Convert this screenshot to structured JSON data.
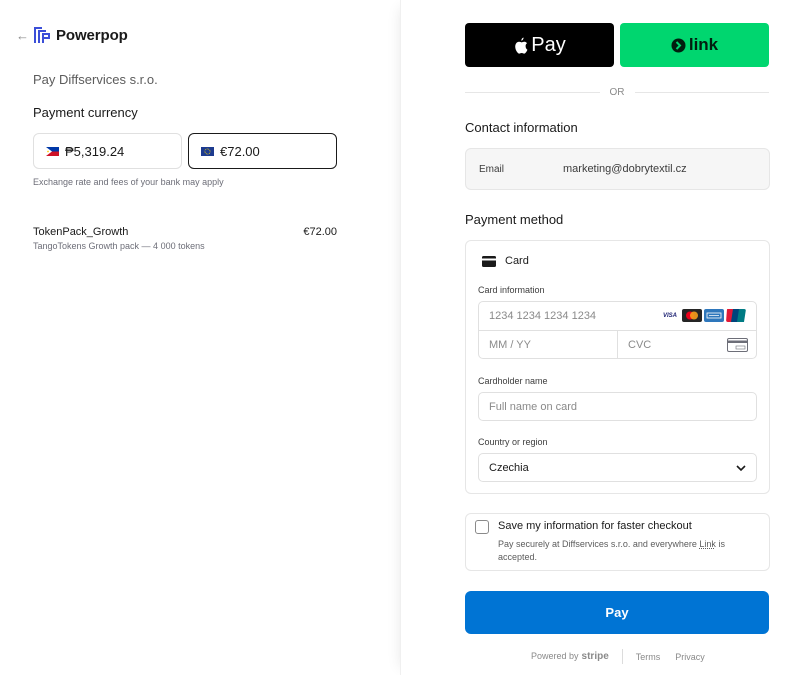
{
  "brand": {
    "name": "Powerpop",
    "back_glyph": "←"
  },
  "order": {
    "pay_to": "Pay Diffservices s.r.o.",
    "currency_title": "Payment currency",
    "currencies": [
      {
        "label": "₱5,319.24",
        "flag": "philippines-flag-icon"
      },
      {
        "label": "€72.00",
        "flag": "eu-flag-icon",
        "selected": true
      }
    ],
    "exchange_note": "Exchange rate and fees of your bank may apply",
    "item": {
      "name": "TokenPack_Growth",
      "price": "€72.00",
      "description": "TangoTokens Growth pack — 4 000 tokens"
    }
  },
  "wallets": {
    "apple_pay": "Pay",
    "link": "link",
    "or": "OR"
  },
  "contact": {
    "title": "Contact information",
    "email_label": "Email",
    "email_value": "marketing@dobrytextil.cz"
  },
  "payment": {
    "title": "Payment method",
    "method": "Card",
    "card_info_label": "Card information",
    "card_number_placeholder": "1234 1234 1234 1234",
    "expiry_placeholder": "MM / YY",
    "cvc_placeholder": "CVC",
    "card_brands": [
      "VISA",
      "mastercard",
      "AMEX",
      "UnionPay"
    ],
    "cardholder_label": "Cardholder name",
    "cardholder_placeholder": "Full name on card",
    "country_label": "Country or region",
    "country_value": "Czechia"
  },
  "save": {
    "title": "Save my information for faster checkout",
    "desc_before": "Pay securely at Diffservices s.r.o. and everywhere ",
    "desc_link": "Link",
    "desc_after": " is accepted."
  },
  "pay_button": "Pay",
  "footer": {
    "powered_by": "Powered by",
    "stripe": "stripe",
    "terms": "Terms",
    "privacy": "Privacy"
  },
  "colors": {
    "accent": "#0074d4",
    "link_green": "#00d66f",
    "apple_black": "#000000"
  }
}
